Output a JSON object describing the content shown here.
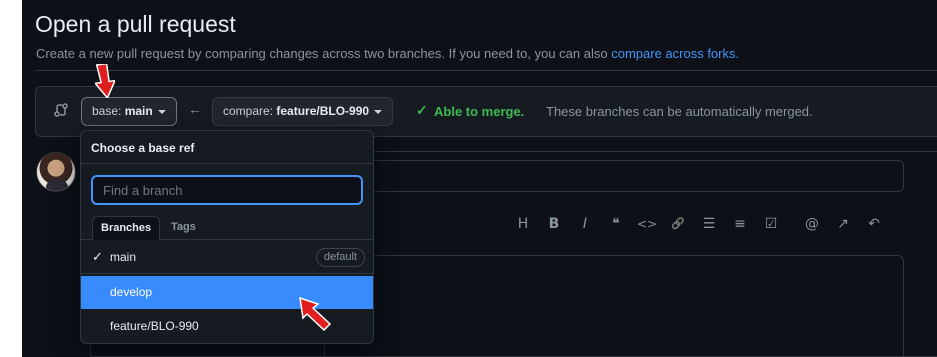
{
  "page": {
    "title": "Open a pull request",
    "subtitle": "Create a new pull request by comparing changes across two branches. If you need to, you can also",
    "subtitle_link": "compare across forks."
  },
  "range": {
    "base_label": "base:",
    "base_value": "main",
    "compare_label": "compare:",
    "compare_value": "feature/BLO-990",
    "merge_status": "Able to merge.",
    "merge_message": "These branches can be automatically merged."
  },
  "dropdown": {
    "header": "Choose a base ref",
    "filter_placeholder": "Find a branch",
    "tabs": [
      "Branches",
      "Tags"
    ],
    "items": [
      {
        "label": "main",
        "checked": true,
        "badge": "default"
      },
      {
        "label": "develop",
        "highlighted": true
      },
      {
        "label": "feature/BLO-990"
      }
    ]
  },
  "toolbar": {
    "icons": [
      "heading-icon",
      "bold-icon",
      "italic-icon",
      "quote-icon",
      "code-icon",
      "link-icon",
      "unordered-list-icon",
      "ordered-list-icon",
      "task-list-icon",
      "mention-icon",
      "reference-icon",
      "reply-icon"
    ],
    "glyphs": [
      "H",
      "B",
      "I",
      "❝",
      "<>",
      "🔗",
      "☰",
      "≡",
      "☑",
      "@",
      "↗",
      "↶"
    ]
  },
  "colors": {
    "accent": "#4493f8",
    "success": "#3fb950",
    "selected": "#388bfd",
    "annotation": "#e01e1e"
  }
}
